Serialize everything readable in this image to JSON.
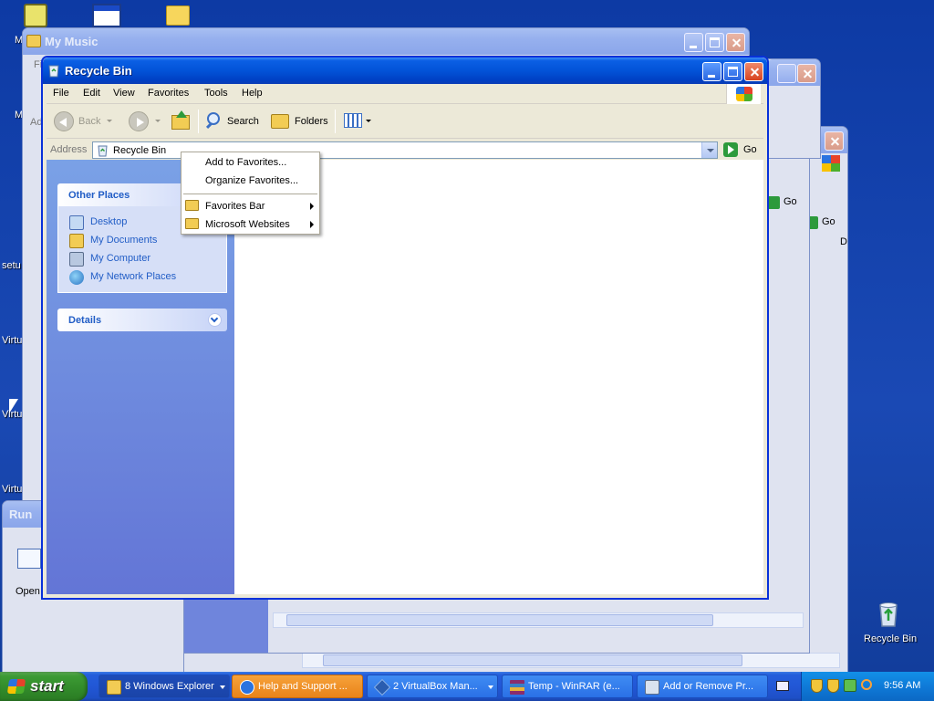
{
  "desktop": {
    "left_labels": [
      "M",
      "M",
      "setu",
      "Virtu",
      "Virtu",
      "Virtu"
    ],
    "recycle_bin_label": "Recycle Bin"
  },
  "windows": {
    "my_music": {
      "title": "My Music",
      "address_fragment": "Ad",
      "menu_fragment": "Fi"
    },
    "recycle_bin": {
      "title": "Recycle Bin",
      "menu": [
        "File",
        "Edit",
        "View",
        "Favorites",
        "Tools",
        "Help"
      ],
      "toolbar": {
        "back": "Back",
        "search": "Search",
        "folders": "Folders"
      },
      "address_label": "Address",
      "address_value": "Recycle Bin",
      "go_label": "Go",
      "other_places": {
        "title": "Other Places",
        "items": [
          "Desktop",
          "My Documents",
          "My Computer",
          "My Network Places"
        ]
      },
      "details_title": "Details"
    },
    "background_go_1": "Go",
    "background_go_2": "Go",
    "background_fragment": "D"
  },
  "favorites_menu": {
    "items": [
      "Add to Favorites...",
      "Organize Favorites...",
      "Favorites Bar",
      "Microsoft Websites"
    ]
  },
  "run_dialog": {
    "title": "Run",
    "open_label": "Open"
  },
  "taskbar": {
    "start_label": "start",
    "tasks": [
      {
        "label": "8 Windows Explorer",
        "icon": "folder-icon"
      },
      {
        "label": "Help and Support ...",
        "icon": "help-icon"
      },
      {
        "label": "2 VirtualBox Man...",
        "icon": "virtualbox-icon"
      },
      {
        "label": "Temp - WinRAR (e...",
        "icon": "winrar-icon"
      },
      {
        "label": "Add or Remove Pr...",
        "icon": "add-remove-icon"
      }
    ],
    "clock": "9:56 AM"
  },
  "colors": {
    "desktop": "#0e3aa3",
    "title_active": "#0253d8",
    "taskpane": "#6f8ee0",
    "start_green": "#3c9a34",
    "link_blue": "#215dc6"
  }
}
